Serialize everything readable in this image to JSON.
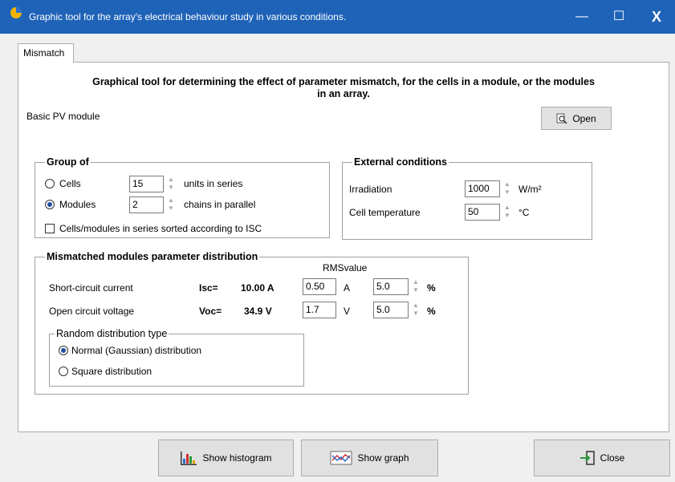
{
  "window": {
    "title": "Graphic tool for the array's electrical behaviour study in various conditions.",
    "minimize_icon": "—",
    "maximize_icon": "☐",
    "close_icon": "X"
  },
  "tabs": [
    {
      "label": "Mismatch"
    }
  ],
  "main": {
    "heading_line1": "Graphical tool for determining the effect of parameter mismatch, for the cells in a module, or the modules",
    "heading_line2": "in an array.",
    "module_label": "Basic PV module",
    "open_button": "Open"
  },
  "group_of": {
    "title": "Group of",
    "cells_label": "Cells",
    "cells_value": "15",
    "cells_unit": "units in series",
    "modules_label": "Modules",
    "modules_value": "2",
    "modules_unit": "chains in parallel",
    "selected": "Modules",
    "sorted_label": "Cells/modules in series sorted according to ISC",
    "sorted_checked": false
  },
  "external": {
    "title": "External conditions",
    "irradiation_label": "Irradiation",
    "irradiation_value": "1000",
    "irradiation_unit": "W/m²",
    "temp_label": "Cell temperature",
    "temp_value": "50",
    "temp_unit": "°C"
  },
  "mismatch": {
    "title": "Mismatched modules parameter distribution",
    "rms_header": "RMSvalue",
    "isc": {
      "label": "Short-circuit current",
      "symbol": "Isc=",
      "value": "10.00 A",
      "rms_abs": "0.50",
      "abs_unit": "A",
      "rms_pct": "5.0",
      "pct_unit": "%"
    },
    "voc": {
      "label": "Open circuit voltage",
      "symbol": "Voc=",
      "value": "34.9 V",
      "rms_abs": "1.7",
      "abs_unit": "V",
      "rms_pct": "5.0",
      "pct_unit": "%"
    },
    "distribution": {
      "title": "Random distribution type",
      "normal_label": "Normal (Gaussian) distribution",
      "square_label": "Square distribution",
      "selected": "Normal (Gaussian) distribution"
    }
  },
  "footer": {
    "histogram_button": "Show histogram",
    "graph_button": "Show graph",
    "close_button": "Close"
  },
  "spin": {
    "up": "▲",
    "down": "▼"
  }
}
